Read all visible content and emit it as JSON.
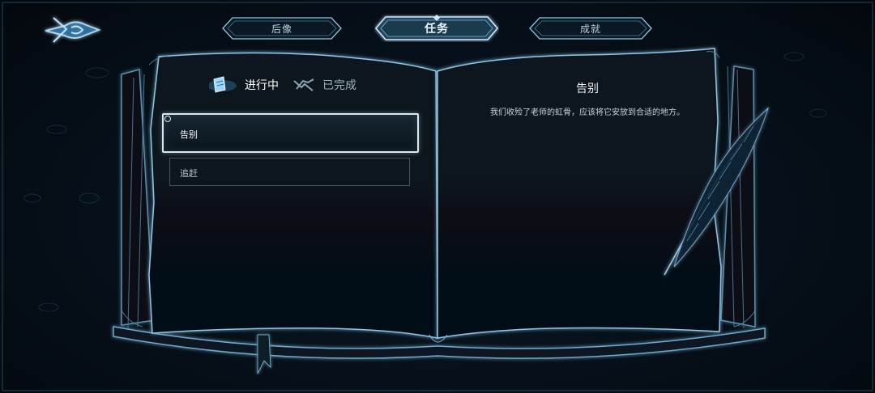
{
  "nav": {
    "tabs": [
      {
        "label": "后像",
        "active": false
      },
      {
        "label": "任务",
        "active": true
      },
      {
        "label": "成就",
        "active": false
      }
    ]
  },
  "quest_filters": {
    "active_label": "进行中",
    "completed_label": "已完成",
    "active_icon": "scroll-icon",
    "completed_icon": "handshake-icon"
  },
  "quests": [
    {
      "name": "告别",
      "selected": true
    },
    {
      "name": "追赶",
      "selected": false
    }
  ],
  "detail": {
    "title": "告别",
    "description": "我们收殓了老师的虹骨，应该将它安放到合适的地方。"
  },
  "colors": {
    "glow": "#8fc6e6",
    "frame": "#6fa8c9",
    "page": "#08131c",
    "text": "#e8f0f5"
  }
}
